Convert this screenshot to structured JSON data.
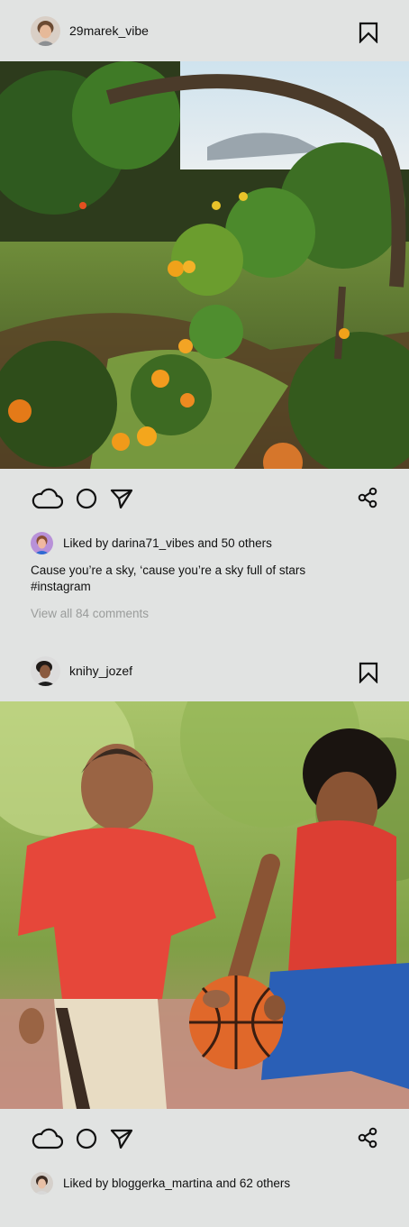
{
  "posts": [
    {
      "username": "29marek_vibe",
      "image_alt": "Orange orchard",
      "likes_text": "Liked by darina71_vibes and 50 others",
      "caption_line1": "Cause you’re a sky, ‘cause you’re a sky full of stars",
      "caption_line2": "#instagram",
      "comments_link": "View all 84 comments"
    },
    {
      "username": "knihy_jozef",
      "image_alt": "Kids playing basketball",
      "likes_text": "Liked by bloggerka_martina and 62 others"
    }
  ],
  "icons": {
    "bookmark": "bookmark-icon",
    "like": "cloud-icon",
    "comment": "circle-icon",
    "send": "send-icon",
    "share": "share-icon"
  }
}
